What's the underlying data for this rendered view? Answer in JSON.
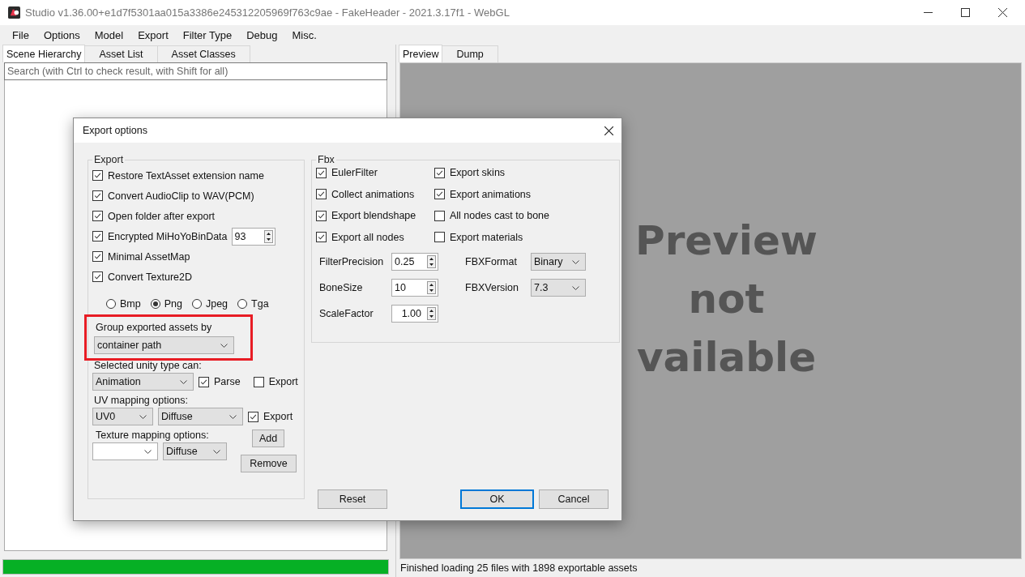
{
  "window": {
    "title": "Studio v1.36.00+e1d7f5301aa015a3386e245312205969f763c9ae - FakeHeader - 2021.3.17f1 - WebGL"
  },
  "menu": [
    "File",
    "Options",
    "Model",
    "Export",
    "Filter Type",
    "Debug",
    "Misc."
  ],
  "left_panel": {
    "tabs": [
      {
        "label": "Scene Hierarchy",
        "selected": true
      },
      {
        "label": "Asset List",
        "selected": false
      },
      {
        "label": "Asset Classes",
        "selected": false
      }
    ],
    "search": {
      "placeholder": "Search (with Ctrl to check result, with Shift for all)"
    },
    "progress": {
      "level": 1
    }
  },
  "right_panel": {
    "tabs": [
      {
        "label": "Preview",
        "selected": true
      },
      {
        "label": "Dump",
        "selected": false
      }
    ],
    "preview_text": [
      "Preview",
      "not",
      "vailable"
    ],
    "status": "Finished loading 25 files with 1898 exportable assets"
  },
  "dialog": {
    "title": "Export options",
    "export_group": {
      "title": "Export",
      "options": [
        {
          "kind": "check",
          "label": "Restore TextAsset extension name",
          "checked": true
        },
        {
          "kind": "check",
          "label": "Convert AudioClip to WAV(PCM)",
          "checked": true
        },
        {
          "kind": "check",
          "label": "Open folder after export",
          "checked": true
        },
        {
          "kind": "spin",
          "label": "Encrypted MiHoYoBinData",
          "checked": true,
          "value": "93"
        },
        {
          "kind": "check",
          "label": "Minimal AssetMap",
          "checked": true
        },
        {
          "kind": "check",
          "label": "Convert Texture2D",
          "checked": true
        }
      ],
      "formats": [
        {
          "label": "Bmp",
          "selected": false
        },
        {
          "label": "Png",
          "selected": true
        },
        {
          "label": "Jpeg",
          "selected": false
        },
        {
          "label": "Tga",
          "selected": false
        }
      ],
      "group_by": {
        "label": "Group exported assets by",
        "value": "container path",
        "highlighted": true
      },
      "unity_type": {
        "label": "Selected unity type can:",
        "value": "Animation",
        "parse": {
          "label": "Parse",
          "checked": true
        },
        "export": {
          "label": "Export",
          "checked": false
        }
      },
      "uv_mapping": {
        "label": "UV mapping options:",
        "channel": "UV0",
        "type": "Diffuse",
        "export": {
          "label": "Export",
          "checked": true
        }
      },
      "texture_mapping": {
        "label": "Texture mapping options:",
        "type": "Diffuse",
        "add": "Add",
        "remove": "Remove"
      }
    },
    "fbx_group": {
      "title": "Fbx",
      "options": [
        {
          "label": "EulerFilter",
          "checked": true
        },
        {
          "label": "Export skins",
          "checked": true
        },
        {
          "label": "Collect animations",
          "checked": true
        },
        {
          "label": "Export animations",
          "checked": true
        },
        {
          "label": "Export blendshape",
          "checked": true
        },
        {
          "label": "All nodes cast to bone",
          "checked": false
        },
        {
          "label": "Export all nodes",
          "checked": true
        },
        {
          "label": "Export materials",
          "checked": false
        }
      ],
      "numbers": [
        {
          "label": "FilterPrecision",
          "value": "0.25"
        },
        {
          "label": "BoneSize",
          "value": "10"
        },
        {
          "label": "ScaleFactor",
          "value": "1.00"
        }
      ],
      "selects": [
        {
          "label": "FBXFormat",
          "value": "Binary"
        },
        {
          "label": "FBXVersion",
          "value": "7.3"
        }
      ]
    },
    "buttons": {
      "reset": "Reset",
      "ok": "OK",
      "cancel": "Cancel"
    }
  }
}
